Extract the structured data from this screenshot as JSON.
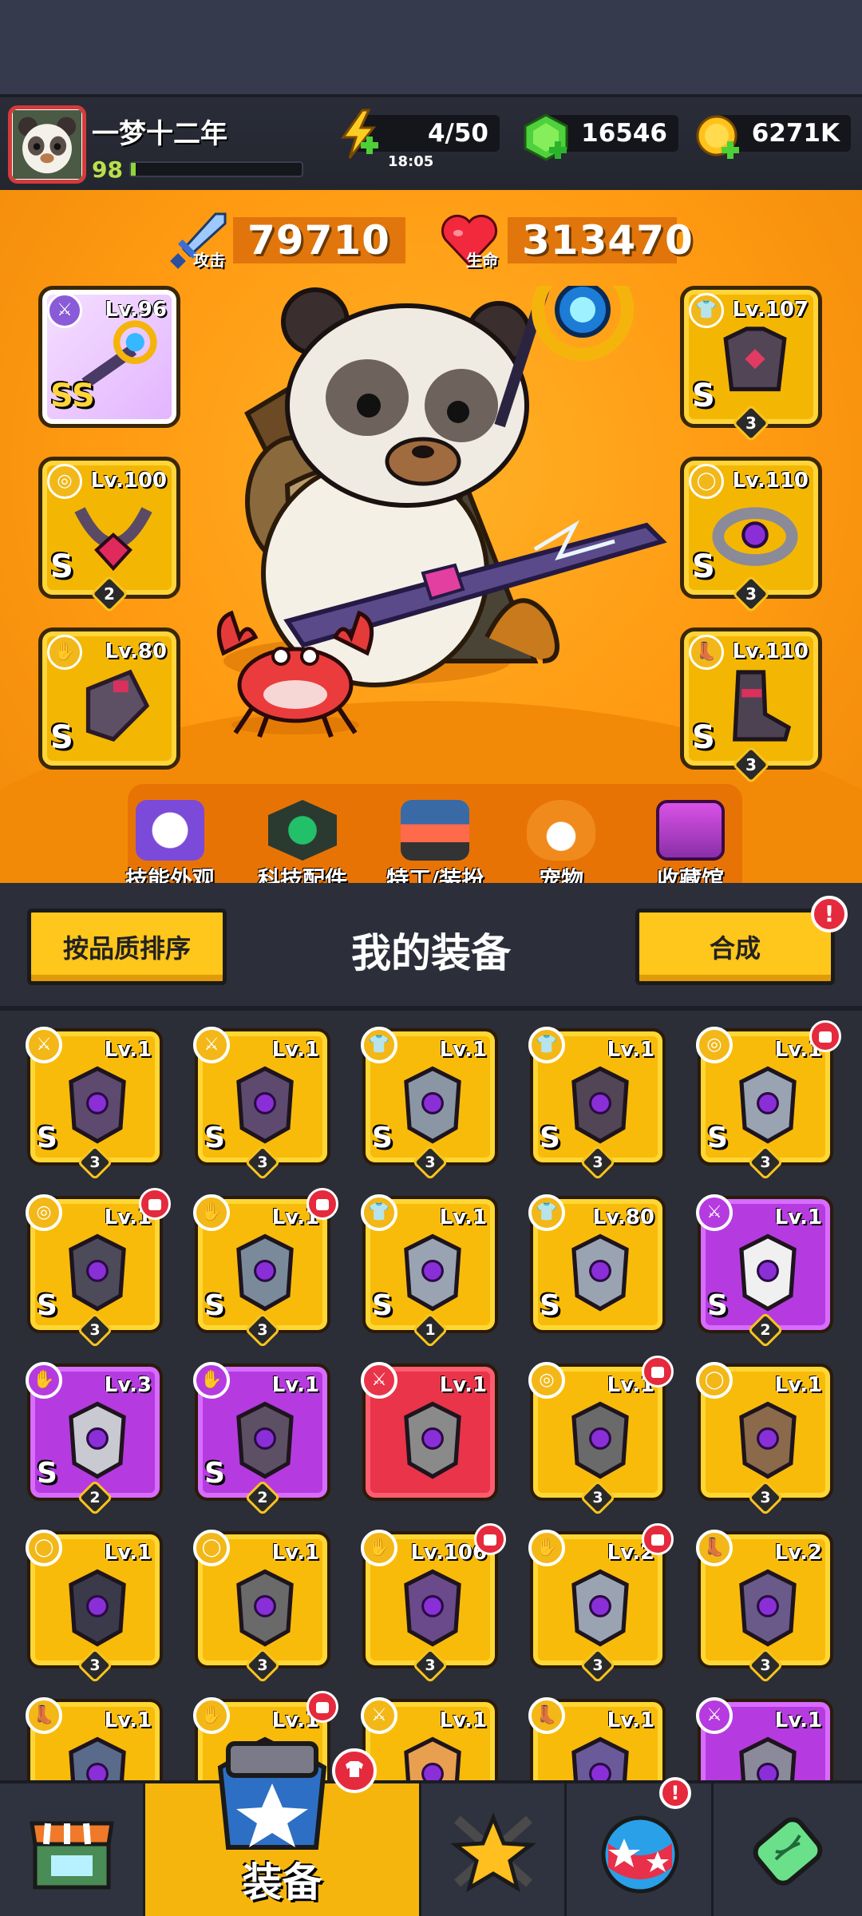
{
  "player": {
    "name": "一梦十二年",
    "level": "98",
    "xp_fraction": 0.03
  },
  "resources": {
    "energy": "4/50",
    "energy_timer": "18:05",
    "gems": "16546",
    "coins": "6271K"
  },
  "stats": {
    "attack_label": "攻击",
    "attack_value": "79710",
    "hp_label": "生命",
    "hp_value": "313470"
  },
  "equipped_left": [
    {
      "level": "Lv.96",
      "grade": "SS",
      "stars": ""
    },
    {
      "level": "Lv.100",
      "grade": "S",
      "stars": "2"
    },
    {
      "level": "Lv.80",
      "grade": "S",
      "stars": ""
    }
  ],
  "equipped_right": [
    {
      "level": "Lv.107",
      "grade": "S",
      "stars": "3"
    },
    {
      "level": "Lv.110",
      "grade": "S",
      "stars": "3"
    },
    {
      "level": "Lv.110",
      "grade": "S",
      "stars": "3"
    }
  ],
  "hero_menu": [
    "技能外观",
    "科技配件",
    "特工/装扮",
    "宠物",
    "收藏馆"
  ],
  "equipment_panel": {
    "sort_label": "按品质排序",
    "title": "我的装备",
    "merge_label": "合成",
    "merge_badge": "!"
  },
  "inventory": [
    {
      "level": "Lv.1",
      "grade": "S",
      "stars": "3",
      "rarity": "gold"
    },
    {
      "level": "Lv.1",
      "grade": "S",
      "stars": "3",
      "rarity": "gold"
    },
    {
      "level": "Lv.1",
      "grade": "S",
      "stars": "3",
      "rarity": "gold"
    },
    {
      "level": "Lv.1",
      "grade": "S",
      "stars": "3",
      "rarity": "gold"
    },
    {
      "level": "Lv.1",
      "grade": "S",
      "stars": "3",
      "rarity": "gold"
    },
    {
      "level": "Lv.1",
      "grade": "S",
      "stars": "3",
      "rarity": "gold"
    },
    {
      "level": "Lv.1",
      "grade": "S",
      "stars": "3",
      "rarity": "gold"
    },
    {
      "level": "Lv.1",
      "grade": "S",
      "stars": "1",
      "rarity": "gold"
    },
    {
      "level": "Lv.80",
      "grade": "S",
      "stars": "",
      "rarity": "gold"
    },
    {
      "level": "Lv.1",
      "grade": "S",
      "stars": "2",
      "rarity": "purple"
    },
    {
      "level": "Lv.3",
      "grade": "S",
      "stars": "2",
      "rarity": "purple"
    },
    {
      "level": "Lv.1",
      "grade": "S",
      "stars": "2",
      "rarity": "purple"
    },
    {
      "level": "Lv.1",
      "grade": "",
      "stars": "",
      "rarity": "red"
    },
    {
      "level": "Lv.1",
      "grade": "",
      "stars": "3",
      "rarity": "gold"
    },
    {
      "level": "Lv.1",
      "grade": "",
      "stars": "3",
      "rarity": "gold"
    },
    {
      "level": "Lv.1",
      "grade": "",
      "stars": "3",
      "rarity": "gold"
    },
    {
      "level": "Lv.1",
      "grade": "",
      "stars": "3",
      "rarity": "gold"
    },
    {
      "level": "Lv.106",
      "grade": "",
      "stars": "3",
      "rarity": "gold"
    },
    {
      "level": "Lv.2",
      "grade": "",
      "stars": "3",
      "rarity": "gold"
    },
    {
      "level": "Lv.2",
      "grade": "",
      "stars": "3",
      "rarity": "gold"
    },
    {
      "level": "Lv.1",
      "grade": "",
      "stars": "",
      "rarity": "gold"
    },
    {
      "level": "Lv.1",
      "grade": "",
      "stars": "",
      "rarity": "gold"
    },
    {
      "level": "Lv.1",
      "grade": "",
      "stars": "",
      "rarity": "gold"
    },
    {
      "level": "Lv.1",
      "grade": "",
      "stars": "",
      "rarity": "gold"
    },
    {
      "level": "Lv.1",
      "grade": "",
      "stars": "",
      "rarity": "purple"
    }
  ],
  "bottom_nav": {
    "active_label": "装备",
    "badge": "!"
  }
}
